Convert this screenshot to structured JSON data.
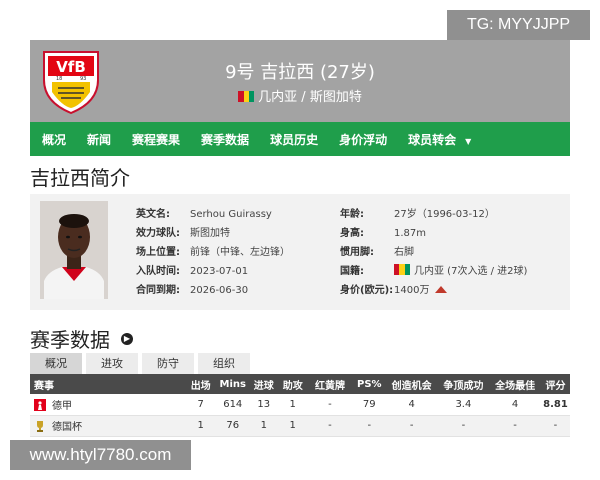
{
  "watermark_top": "TG: MYYJJPP",
  "watermark_bottom": "www.htyl7780.com",
  "header": {
    "title": "9号 吉拉西 (27岁)",
    "subtitle": "几内亚 / 斯图加特",
    "crest_icon": "vfb-stuttgart-crest-icon",
    "flag_colors": [
      "#ce1126",
      "#fcd116",
      "#009460"
    ]
  },
  "nav": {
    "items": [
      "概况",
      "新闻",
      "赛程赛果",
      "赛季数据",
      "球员历史",
      "身价浮动",
      "球员转会"
    ],
    "more_icon": "▼"
  },
  "intro": {
    "title": "吉拉西简介",
    "left": [
      {
        "label": "英文名:",
        "value": "Serhou Guirassy"
      },
      {
        "label": "效力球队:",
        "value": "斯图加特"
      },
      {
        "label": "场上位置:",
        "value": "前锋（中锋、左边锋）"
      },
      {
        "label": "入队时间:",
        "value": "2023-07-01"
      },
      {
        "label": "合同到期:",
        "value": "2026-06-30"
      }
    ],
    "right": [
      {
        "label": "年龄:",
        "value": "27岁（1996-03-12）"
      },
      {
        "label": "身高:",
        "value": "1.87m"
      },
      {
        "label": "惯用脚:",
        "value": "右脚"
      },
      {
        "label": "国籍:",
        "value": "几内亚 (7次入选 / 进2球)"
      },
      {
        "label": "身价(欧元):",
        "value": "1400万"
      }
    ],
    "value_trend": "up",
    "trend_color": "#c0392b"
  },
  "season": {
    "title": "赛季数据",
    "tabs": [
      "概况",
      "进攻",
      "防守",
      "组织"
    ],
    "active_tab": "概况",
    "columns": [
      "赛事",
      "出场",
      "Mins",
      "进球",
      "助攻",
      "红黄牌",
      "PS%",
      "创造机会",
      "争顶成功",
      "全场最佳",
      "评分"
    ],
    "rows": [
      {
        "comp": "德甲",
        "icon": "bundesliga-icon",
        "cells": [
          "7",
          "614",
          "13",
          "1",
          "-",
          "79",
          "4",
          "3.4",
          "4",
          "8.81"
        ]
      },
      {
        "comp": "德国杯",
        "icon": "dfb-pokal-icon",
        "cells": [
          "1",
          "76",
          "1",
          "1",
          "-",
          "-",
          "-",
          "-",
          "-",
          "-"
        ]
      }
    ],
    "rating_color": "#d98c0f"
  }
}
